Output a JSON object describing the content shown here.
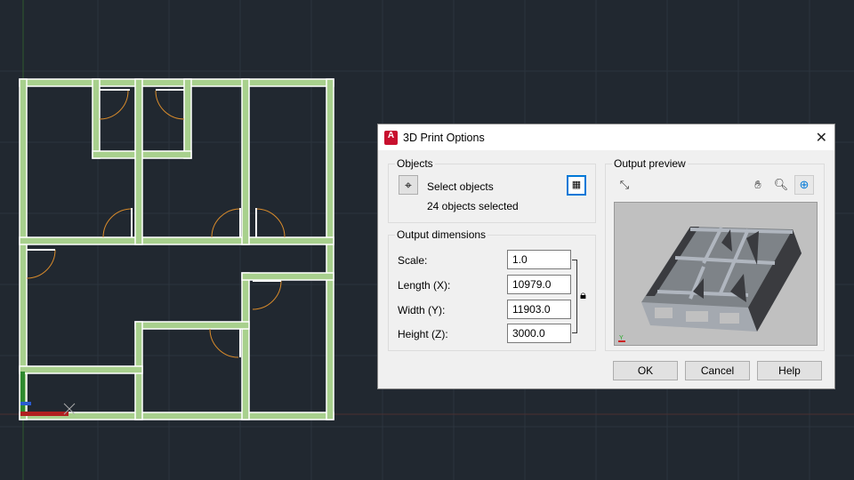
{
  "dialog": {
    "title": "3D Print Options",
    "close_label": "✕",
    "objects": {
      "group_label": "Objects",
      "select_label": "Select objects",
      "selected_count": "24 objects selected"
    },
    "output_dimensions": {
      "group_label": "Output dimensions",
      "fields": [
        {
          "label": "Scale:",
          "value": "1.0"
        },
        {
          "label": "Length (X):",
          "value": "10979.0"
        },
        {
          "label": "Width (Y):",
          "value": "11903.0"
        },
        {
          "label": "Height (Z):",
          "value": "3000.0"
        }
      ]
    },
    "preview": {
      "group_label": "Output preview"
    },
    "buttons": {
      "ok": "OK",
      "cancel": "Cancel",
      "help": "Help"
    }
  },
  "colors": {
    "wall": "#a8d08d",
    "background": "#212830",
    "door": "#d98b2b"
  }
}
